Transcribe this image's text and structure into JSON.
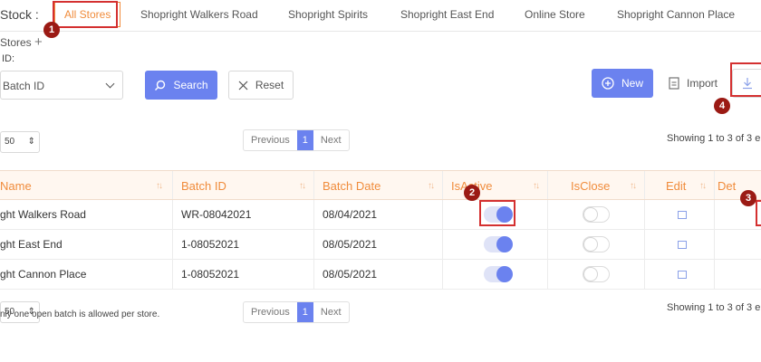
{
  "header": {
    "stock_label": "Stock :",
    "tabs": [
      {
        "label": "All Stores"
      },
      {
        "label": "Shopright Walkers Road"
      },
      {
        "label": "Shopright Spirits"
      },
      {
        "label": "Shopright East End"
      },
      {
        "label": "Online Store"
      },
      {
        "label": "Shopright Cannon Place"
      }
    ]
  },
  "section": {
    "title": "Stores",
    "add_icon": "plus-icon"
  },
  "filter": {
    "id_label": "ID:",
    "batch_select": "Batch ID",
    "search_label": "Search",
    "reset_label": "Reset"
  },
  "actions": {
    "new_label": "New",
    "import_label": "Import",
    "download_icon": "download-icon"
  },
  "pagination": {
    "page_size": "50",
    "previous": "Previous",
    "current": "1",
    "next": "Next",
    "showing_top": "Showing 1 to 3 of 3 e",
    "showing_bottom": "Showing 1 to 3 of 3 e"
  },
  "table": {
    "columns": [
      "Name",
      "Batch ID",
      "Batch Date",
      "IsActive",
      "IsClose",
      "Edit",
      "Det"
    ],
    "rows": [
      {
        "name": "ght Walkers Road",
        "batch_id": "WR-08042021",
        "batch_date": "08/04/2021",
        "is_active": true,
        "is_close": false
      },
      {
        "name": "ght East End",
        "batch_id": "1-08052021",
        "batch_date": "08/05/2021",
        "is_active": true,
        "is_close": false
      },
      {
        "name": "ght Cannon Place",
        "batch_id": "1-08052021",
        "batch_date": "08/05/2021",
        "is_active": true,
        "is_close": false
      }
    ]
  },
  "footnote": "nly one open batch is allowed per store.",
  "annotations": [
    "1",
    "2",
    "3",
    "4"
  ],
  "colors": {
    "accent": "#f08c3c",
    "primary": "#6b82ef",
    "callout": "#d43030"
  }
}
